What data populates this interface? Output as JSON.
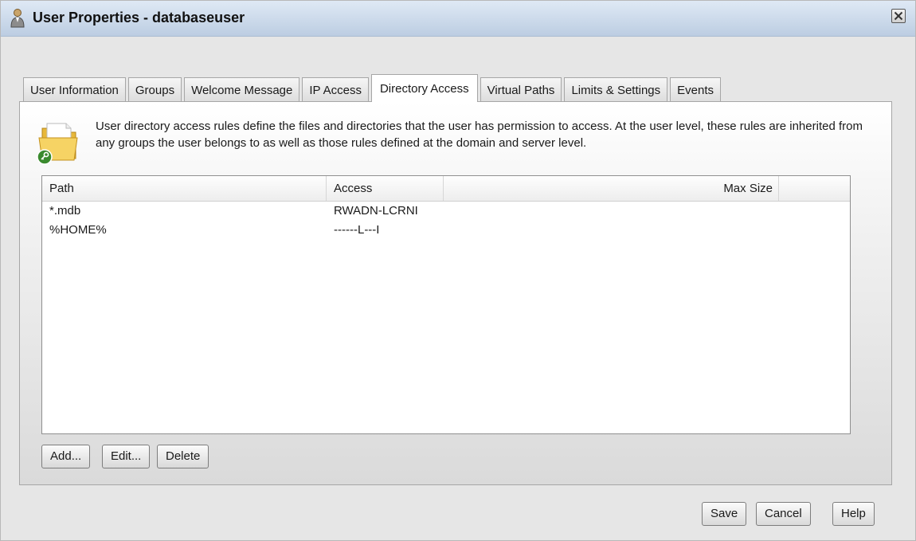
{
  "window": {
    "title": "User Properties - databaseuser"
  },
  "tabs": [
    {
      "label": "User Information",
      "active": false
    },
    {
      "label": "Groups",
      "active": false
    },
    {
      "label": "Welcome Message",
      "active": false
    },
    {
      "label": "IP Access",
      "active": false
    },
    {
      "label": "Directory Access",
      "active": true
    },
    {
      "label": "Virtual Paths",
      "active": false
    },
    {
      "label": "Limits & Settings",
      "active": false
    },
    {
      "label": "Events",
      "active": false
    }
  ],
  "directory_access": {
    "icon": "folder-key-icon",
    "description": "User directory access rules define the files and directories that the user has permission to access. At the user level, these rules are inherited from any groups the user belongs to as well as those rules defined at the domain and server level.",
    "columns": {
      "path": "Path",
      "access": "Access",
      "max_size": "Max Size"
    },
    "rows": [
      {
        "path": "*.mdb",
        "access": "RWADN-LCRNI",
        "max_size": ""
      },
      {
        "path": "%HOME%",
        "access": "------L---I",
        "max_size": ""
      }
    ],
    "buttons": {
      "add": "Add...",
      "edit": "Edit...",
      "delete": "Delete"
    }
  },
  "footer": {
    "save": "Save",
    "cancel": "Cancel",
    "help": "Help"
  },
  "colors": {
    "titlebar": "#bccde2",
    "window_bg": "#e6e6e6",
    "folder": "#f2c94c",
    "key_badge": "#3a8a2e"
  }
}
